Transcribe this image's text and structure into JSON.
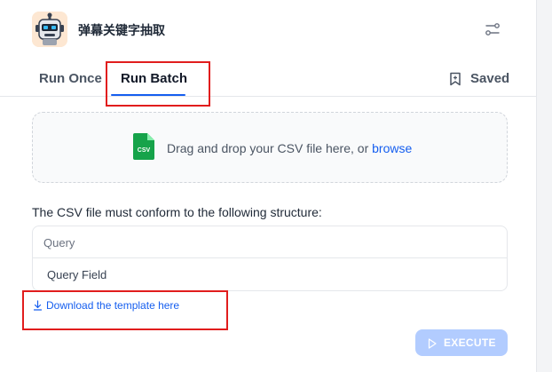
{
  "app": {
    "title": "弹幕关键字抽取"
  },
  "tabs": [
    {
      "label": "Run Once"
    },
    {
      "label": "Run Batch"
    }
  ],
  "saved": {
    "label": "Saved",
    "icon": "bookmark-icon"
  },
  "upload": {
    "prefix": "Drag and drop your CSV file here, or ",
    "browse": "browse",
    "icon_text": "CSV"
  },
  "structure": {
    "label": "The CSV file must conform to the following structure:",
    "header": "Query",
    "row": "Query Field"
  },
  "download": {
    "label": "Download the template here"
  },
  "execute": {
    "label": "EXECUTE"
  },
  "colors": {
    "accent": "#155eef",
    "highlight": "#e11d1d",
    "execute_disabled": "#b2ccff",
    "csv_icon": "#16a34a"
  }
}
